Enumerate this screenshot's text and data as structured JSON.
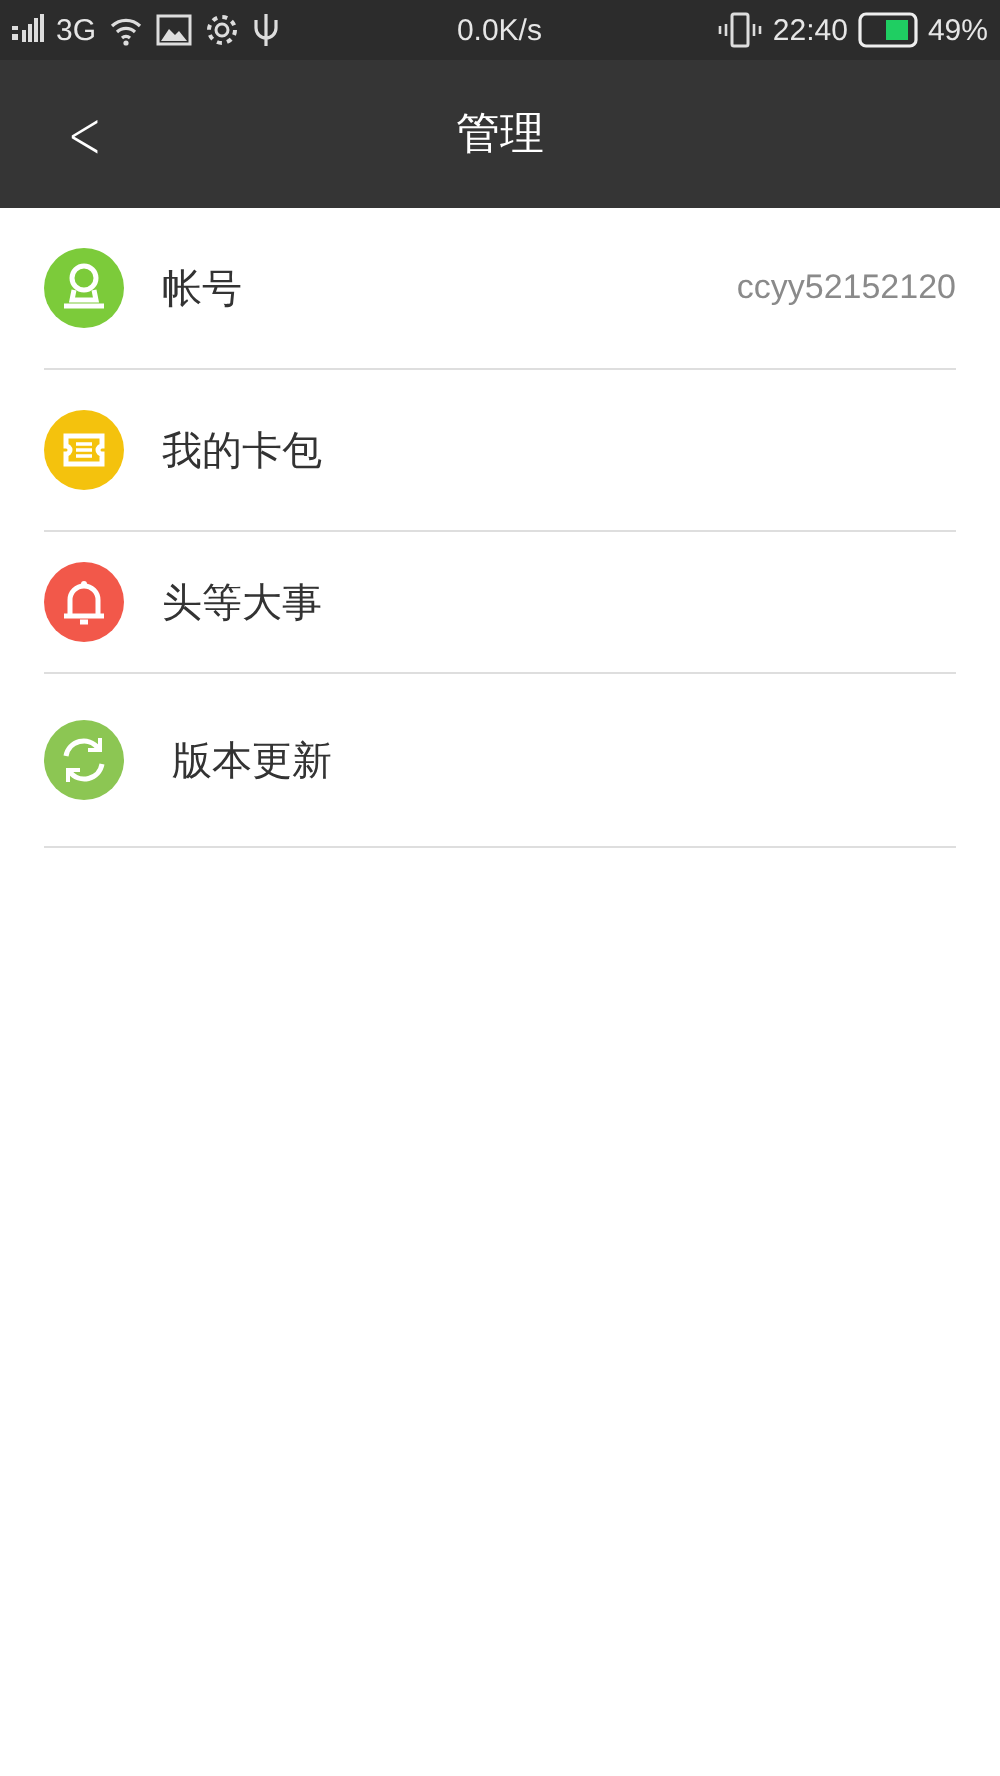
{
  "status_bar": {
    "network": "3G",
    "speed": "0.0K/s",
    "time": "22:40",
    "battery": "49%"
  },
  "header": {
    "back": "<",
    "title": "管理"
  },
  "items": [
    {
      "kind": "account",
      "label": "帐号",
      "value": "ccyy52152120",
      "color": "#7ccb3a"
    },
    {
      "kind": "wallet",
      "label": "我的卡包",
      "color": "#f4c20d"
    },
    {
      "kind": "news",
      "label": "头等大事",
      "color": "#f2584a"
    },
    {
      "kind": "update",
      "label": "版本更新",
      "color": "#8cc653"
    }
  ]
}
